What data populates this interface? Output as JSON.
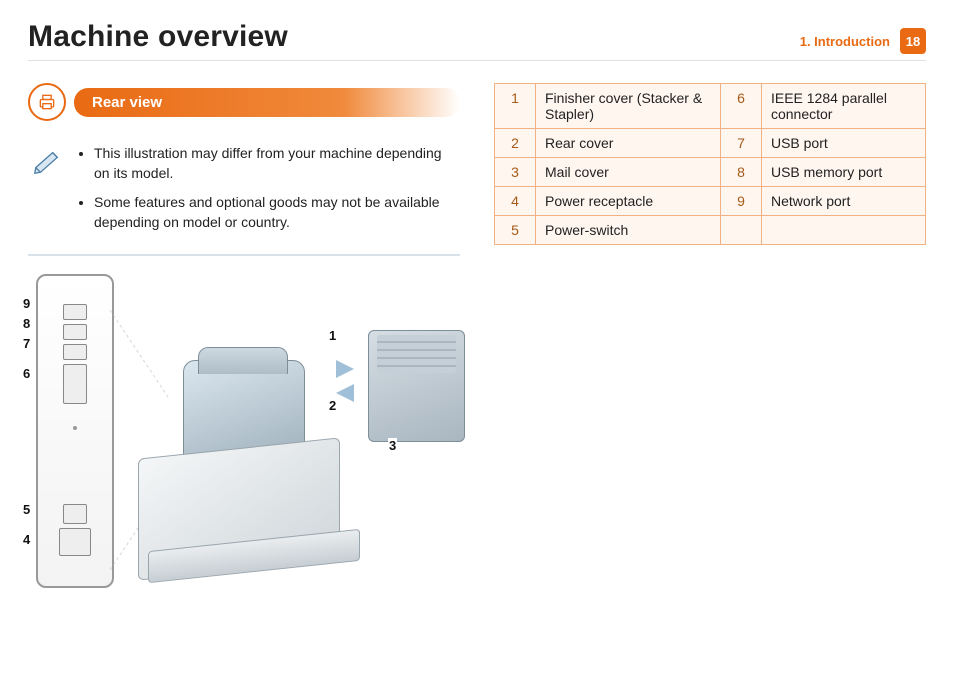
{
  "header": {
    "title": "Machine overview",
    "chapter": "1.  Introduction",
    "page": "18"
  },
  "section": {
    "heading": "Rear view"
  },
  "notes": {
    "items": [
      "This illustration may differ from your machine depending on its model.",
      "Some features and optional goods may not be available depending on model or country."
    ]
  },
  "callouts": {
    "c1": "1",
    "c2": "2",
    "c3": "3",
    "c4": "4",
    "c5": "5",
    "c6": "6",
    "c7": "7",
    "c8": "8",
    "c9": "9"
  },
  "parts": {
    "left": [
      {
        "n": "1",
        "t": "Finisher cover (Stacker & Stapler)"
      },
      {
        "n": "2",
        "t": "Rear cover"
      },
      {
        "n": "3",
        "t": "Mail cover"
      },
      {
        "n": "4",
        "t": "Power receptacle"
      },
      {
        "n": "5",
        "t": "Power-switch"
      }
    ],
    "right": [
      {
        "n": "6",
        "t": "IEEE 1284 parallel connector"
      },
      {
        "n": "7",
        "t": "USB port"
      },
      {
        "n": "8",
        "t": "USB memory port"
      },
      {
        "n": "9",
        "t": "Network port"
      }
    ]
  }
}
